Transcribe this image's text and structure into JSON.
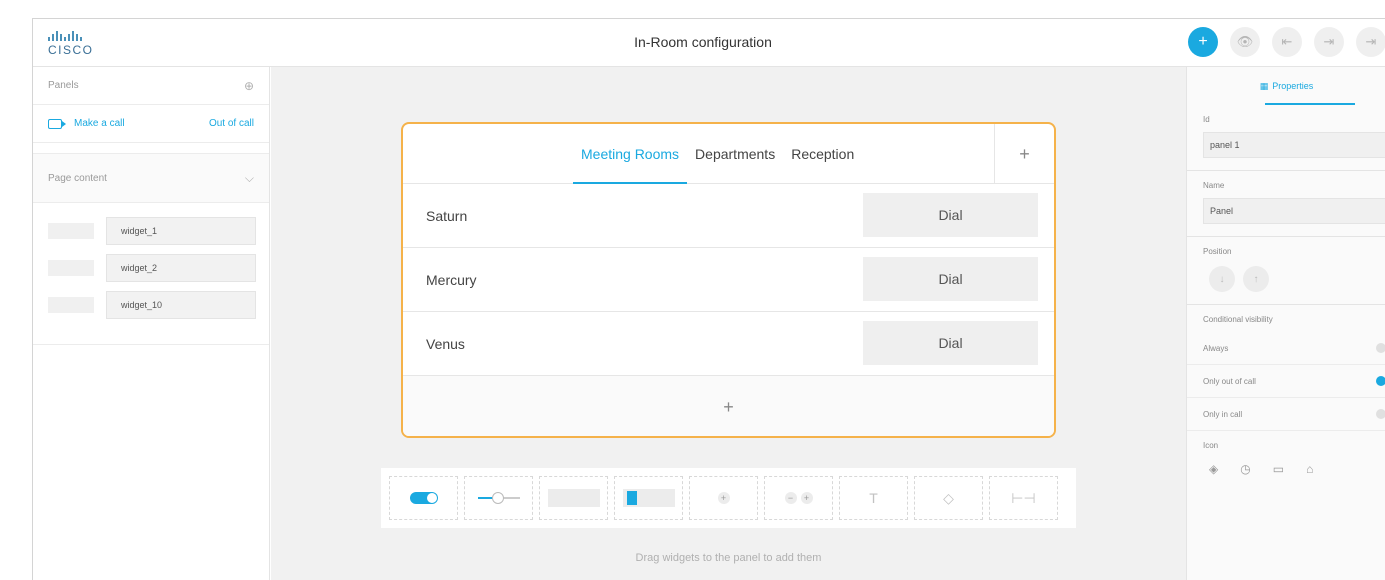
{
  "header": {
    "logo_text": "CISCO",
    "title": "In-Room configuration",
    "actions": [
      {
        "name": "add-panel-button",
        "glyph": "+"
      },
      {
        "name": "preview-button",
        "glyph": "👁"
      },
      {
        "name": "import-button",
        "glyph": "⇤"
      },
      {
        "name": "export-button",
        "glyph": "⇥"
      },
      {
        "name": "more-button",
        "glyph": "⇥"
      }
    ]
  },
  "sidebar": {
    "panels_label": "Panels",
    "panel_item": {
      "label": "Make a call",
      "state": "Out of call"
    },
    "page_content_label": "Page content",
    "widgets": [
      "widget_1",
      "widget_2",
      "widget_10"
    ]
  },
  "panel": {
    "tabs": [
      "Meeting Rooms",
      "Departments",
      "Reception"
    ],
    "active_tab": "Meeting Rooms",
    "add_tab": "+",
    "rows": [
      {
        "name": "Saturn",
        "button": "Dial"
      },
      {
        "name": "Mercury",
        "button": "Dial"
      },
      {
        "name": "Venus",
        "button": "Dial"
      }
    ],
    "add_row": "+"
  },
  "widget_bar": {
    "items": [
      "toggle",
      "slider",
      "button",
      "group-button",
      "spinner",
      "spinner-double",
      "text",
      "directional-pad",
      "spacer"
    ],
    "text_glyph": "T",
    "spinner_glyph": "+",
    "spacer_glyph": "⊢⊣",
    "dpad_glyph": "◇",
    "hint": "Drag widgets to the panel to add them"
  },
  "properties": {
    "tab_label": "Properties",
    "id_label": "Id",
    "id_value": "panel 1",
    "name_label": "Name",
    "name_value": "Panel",
    "position_label": "Position",
    "pos_down": "↓",
    "pos_up": "↑",
    "condition_label": "Conditional visibility",
    "conditions": [
      {
        "label": "Always",
        "selected": false
      },
      {
        "label": "Only out of call",
        "selected": true
      },
      {
        "label": "Only in call",
        "selected": false
      }
    ],
    "icon_label": "Icon",
    "icons": [
      "◈",
      "◷",
      "▭",
      "⌂"
    ]
  },
  "colors": {
    "accent": "#1aa9e0",
    "panel_border": "#f5b24a"
  }
}
